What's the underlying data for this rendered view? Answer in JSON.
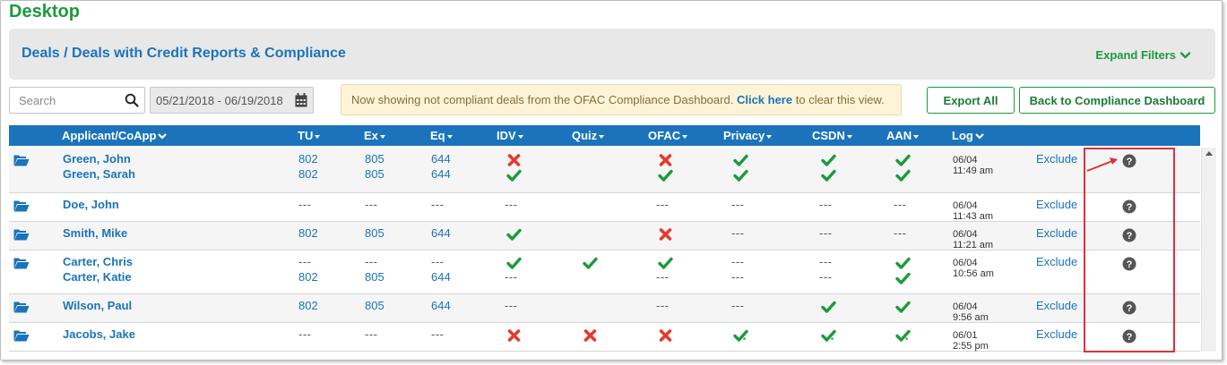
{
  "app_title": "Desktop",
  "header": {
    "breadcrumb": "Deals / Deals with Credit Reports & Compliance",
    "expand_filters": "Expand Filters"
  },
  "toolbar": {
    "search_placeholder": "Search",
    "date_range": "05/21/2018 - 06/19/2018",
    "notice_prefix": "Now showing not compliant deals from the OFAC Compliance Dashboard.",
    "notice_link": "Click here",
    "notice_suffix": "to clear this view.",
    "export_all": "Export All",
    "back_to_dashboard": "Back to Compliance Dashboard"
  },
  "columns": {
    "applicant": "Applicant/CoApp",
    "tu": "TU",
    "ex": "Ex",
    "eq": "Eq",
    "idv": "IDV",
    "quiz": "Quiz",
    "ofac": "OFAC",
    "privacy": "Privacy",
    "csdn": "CSDN",
    "aan": "AAN",
    "log": "Log"
  },
  "rows": [
    {
      "names": [
        "Green, John",
        "Green, Sarah"
      ],
      "tu": [
        "802",
        "802"
      ],
      "ex": [
        "805",
        "805"
      ],
      "eq": [
        "644",
        "644"
      ],
      "idv": [
        "fail",
        "pass"
      ],
      "quiz": [
        "",
        ""
      ],
      "ofac": [
        "fail",
        "pass"
      ],
      "privacy": [
        "pass",
        "pass"
      ],
      "csdn": [
        "pass",
        "pass"
      ],
      "aan": [
        "pass",
        "pass"
      ],
      "log_date": "06/04",
      "log_time": "11:49 am",
      "exclude": "Exclude"
    },
    {
      "names": [
        "Doe, John"
      ],
      "tu": [
        "---"
      ],
      "ex": [
        "---"
      ],
      "eq": [
        "---"
      ],
      "idv": [
        "---"
      ],
      "quiz": [
        ""
      ],
      "ofac": [
        "---"
      ],
      "privacy": [
        "---"
      ],
      "csdn": [
        "---"
      ],
      "aan": [
        "---"
      ],
      "log_date": "06/04",
      "log_time": "11:43 am",
      "exclude": "Exclude"
    },
    {
      "names": [
        "Smith, Mike"
      ],
      "tu": [
        "802"
      ],
      "ex": [
        "805"
      ],
      "eq": [
        "644"
      ],
      "idv": [
        "pass"
      ],
      "quiz": [
        ""
      ],
      "ofac": [
        "fail"
      ],
      "privacy": [
        "---"
      ],
      "csdn": [
        "---"
      ],
      "aan": [
        "---"
      ],
      "log_date": "06/04",
      "log_time": "11:21 am",
      "exclude": "Exclude"
    },
    {
      "names": [
        "Carter, Chris",
        "Carter, Katie"
      ],
      "tu": [
        "---",
        "802"
      ],
      "ex": [
        "---",
        "805"
      ],
      "eq": [
        "---",
        "644"
      ],
      "idv": [
        "pass",
        "---"
      ],
      "quiz": [
        "pass",
        ""
      ],
      "ofac": [
        "pass",
        "---"
      ],
      "privacy": [
        "---",
        "---"
      ],
      "csdn": [
        "---",
        "---"
      ],
      "aan": [
        "pass",
        "pass"
      ],
      "log_date": "06/04",
      "log_time": "10:56 am",
      "exclude": "Exclude"
    },
    {
      "names": [
        "Wilson, Paul"
      ],
      "tu": [
        "802"
      ],
      "ex": [
        "805"
      ],
      "eq": [
        "644"
      ],
      "idv": [
        "---"
      ],
      "quiz": [
        ""
      ],
      "ofac": [
        "---"
      ],
      "privacy": [
        "---"
      ],
      "csdn": [
        "pass"
      ],
      "aan": [
        "pass"
      ],
      "log_date": "06/04",
      "log_time": "9:56 am",
      "exclude": "Exclude"
    },
    {
      "names": [
        "Jacobs, Jake"
      ],
      "tu": [
        "---"
      ],
      "ex": [
        "---"
      ],
      "eq": [
        "---"
      ],
      "idv": [
        "fail"
      ],
      "quiz": [
        "fail"
      ],
      "ofac": [
        "fail"
      ],
      "privacy": [
        "pass-star"
      ],
      "csdn": [
        "pass-star"
      ],
      "aan": [
        "pass-star"
      ],
      "log_date": "06/01",
      "log_time": "2:55 pm",
      "exclude": "Exclude"
    }
  ],
  "colors": {
    "brand_green": "#1c9a3b",
    "link_blue": "#1b74bb",
    "header_blue": "#1b74bb",
    "fail_red": "#e23b2e",
    "pass_green": "#1a9b3c",
    "highlight_red": "#e0303a"
  },
  "icons": {
    "folder": "folder-open-icon",
    "help": "question-circle-icon",
    "search": "search-icon",
    "calendar": "calendar-icon"
  }
}
